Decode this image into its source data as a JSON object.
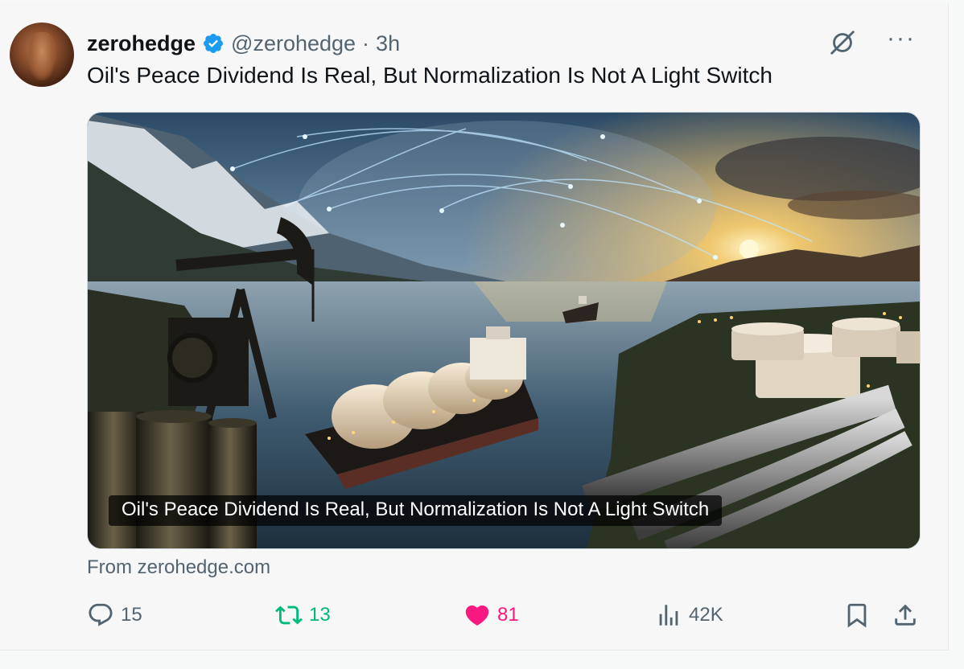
{
  "author": {
    "display_name": "zerohedge",
    "handle": "@zerohedge",
    "separator": "·",
    "time": "3h",
    "verified": true,
    "verified_color": "#1d9bf0"
  },
  "tweet": {
    "text": "Oil's Peace Dividend Is Real, But Normalization Is Not A Light Switch"
  },
  "card": {
    "caption": "Oil's Peace Dividend Is Real, But Normalization Is Not A Light Switch",
    "source": "From zerohedge.com"
  },
  "actions": {
    "replies": "15",
    "retweets": "13",
    "likes": "81",
    "views": "42K",
    "retweet_color": "#00ba7c",
    "like_color": "#f91880"
  },
  "icons": [
    "verified-badge-icon",
    "grok-icon",
    "more-icon",
    "reply-icon",
    "retweet-icon",
    "like-icon",
    "views-icon",
    "bookmark-icon",
    "share-icon"
  ]
}
